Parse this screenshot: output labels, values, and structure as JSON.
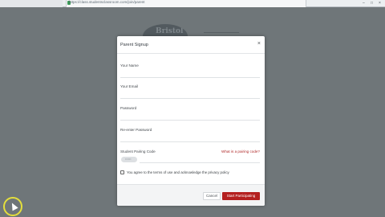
{
  "browser": {
    "url": "https://class.studentsclassroom.com/join/parent"
  },
  "modal": {
    "title": "Parent Signup",
    "close_icon": "×",
    "fields": {
      "name_label": "Your Name",
      "email_label": "Your Email",
      "password_label": "Password",
      "reenter_label": "Re-enter Password",
      "code_label": "Student Pairing Code",
      "code_value": "••••••"
    },
    "help_link": "What is a pairing code?",
    "agree_text": "You agree to the terms of use and acknowledge the privacy policy",
    "cancel_label": "Cancel",
    "start_label": "Start Participating"
  },
  "colors": {
    "overlay": "#6f7679",
    "primary_button": "#b4201f",
    "link": "#b02a2a",
    "cursor_highlight": "#e4df3c"
  },
  "icons": {
    "close": "close-icon",
    "lock": "lock-icon",
    "cursor": "mouse-cursor-icon"
  }
}
